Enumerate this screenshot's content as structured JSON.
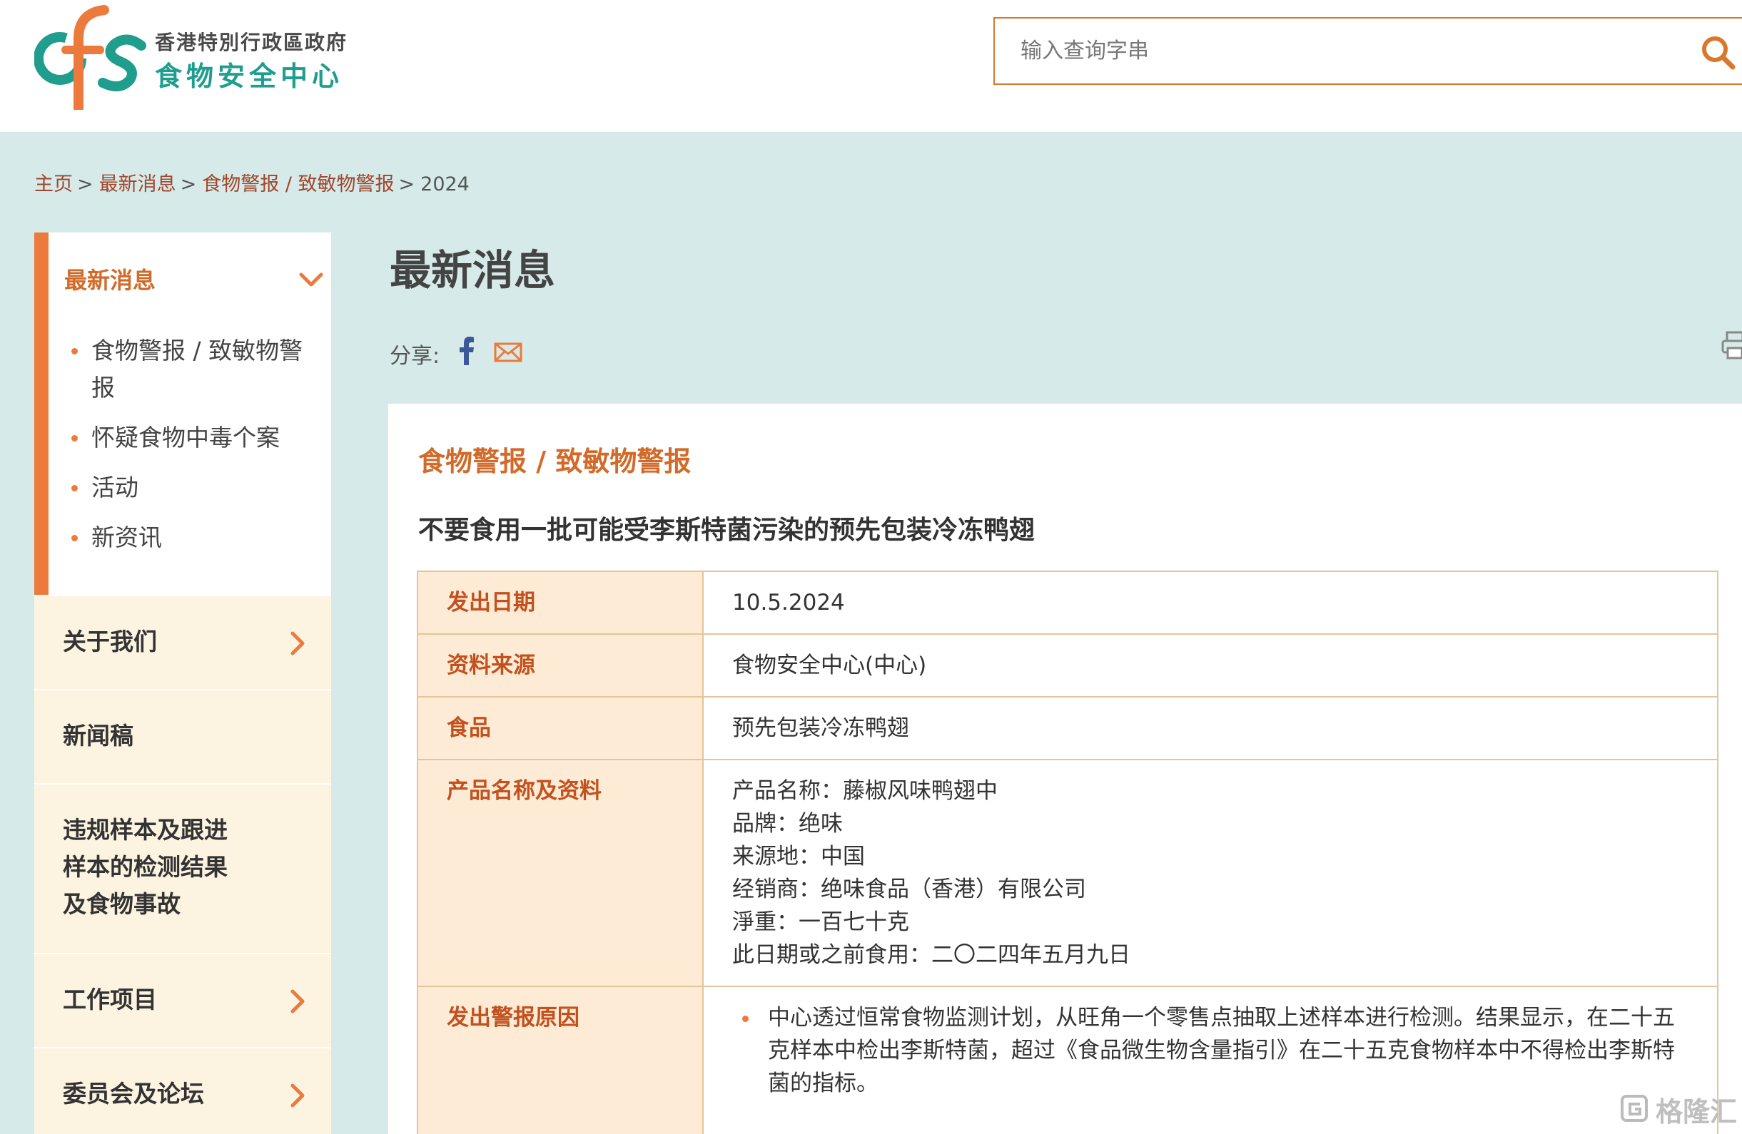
{
  "header": {
    "logo_letters": "cfs",
    "org_name": "香港特別行政區政府",
    "center_name": "食物安全中心",
    "search": {
      "placeholder": "输入查询字串"
    }
  },
  "breadcrumb": {
    "items": [
      "主页",
      "最新消息",
      "食物警报 / 致敏物警报"
    ],
    "current": "2024",
    "separator": ">"
  },
  "sidebar": {
    "active_title": "最新消息",
    "sub_items": [
      "食物警报 / 致敏物警报",
      "怀疑食物中毒个案",
      "活动",
      "新资讯"
    ],
    "items": [
      {
        "label": "关于我们",
        "has_arrow": true
      },
      {
        "label": "新闻稿",
        "has_arrow": false
      },
      {
        "label": "违规样本及跟进样本的检测结果及食物事故",
        "lines": [
          "违规样本及跟进",
          "样本的检测结果",
          "及食物事故"
        ],
        "has_arrow": false
      },
      {
        "label": "工作项目",
        "has_arrow": true
      },
      {
        "label": "委员会及论坛",
        "has_arrow": true
      }
    ]
  },
  "main": {
    "page_title": "最新消息",
    "share_label": "分享:",
    "section_title": "食物警报 / 致敏物警报",
    "notice_title": "不要食用一批可能受李斯特菌污染的预先包装冷冻鸭翅",
    "table": {
      "date_label": "发出日期",
      "date_value": "10.5.2024",
      "source_label": "资料来源",
      "source_value": "食物安全中心(中心)",
      "food_label": "食品",
      "food_value": "预先包装冷冻鸭翅",
      "product_label": "产品名称及资料",
      "product_lines": [
        "产品名称：藤椒风味鸭翅中",
        "品牌：绝味",
        "来源地：中国",
        "经销商：绝味食品（香港）有限公司",
        "淨重：一百七十克",
        "此日期或之前食用：二〇二四年五月九日"
      ],
      "reason_label": "发出警报原因",
      "reason_items": [
        "中心透过恒常食物监测计划，从旺角一个零售点抽取上述样本进行检测。结果显示，在二十五克样本中检出李斯特菌，超过《食品微生物含量指引》在二十五克食物样本中不得检出李斯特菌的指标。"
      ]
    }
  },
  "watermark": {
    "text": "格隆汇"
  },
  "colors": {
    "brand_orange": "#ec7a3c",
    "brand_teal": "#1f9e8e",
    "page_bg": "#d6ebe9",
    "table_key_bg": "#fdebd6",
    "table_border": "#e7c39a",
    "sidebar_item_bg": "#fdf3e1"
  }
}
